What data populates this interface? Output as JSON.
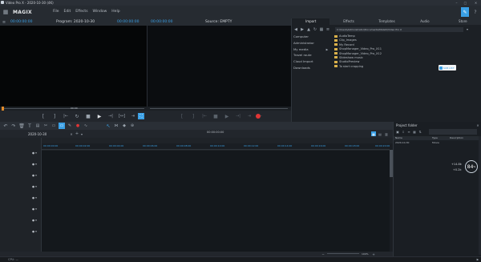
{
  "window": {
    "title": "Video Pro X - 2020-10-30 (4K)"
  },
  "menu": {
    "brand": "MAGIX",
    "items": [
      "File",
      "Edit",
      "Effects",
      "Window",
      "Help"
    ]
  },
  "program_monitor": {
    "timecode_left": "00:00:00:00",
    "label": "Program: 2020-10-30",
    "timecode_right": "00:00:00:00",
    "ruler_value": "00:00"
  },
  "source_monitor": {
    "timecode": "00:00:00:00",
    "label": "Source: EMPTY"
  },
  "media_pool": {
    "tabs": [
      "Import",
      "Effects",
      "Templates",
      "Audio",
      "Store"
    ],
    "path": "C:\\Users\\Administrator\\Documents\\MAGIX\\Video Pro X",
    "places": [
      "Computer",
      "Administrator",
      "My media",
      "Travel route",
      "Cloud Import",
      "Downloads"
    ],
    "files": [
      "AudioTemp",
      "Clip_Images",
      "My Record",
      "ShopManager_Video_Pro_X11",
      "ShopManager_Video_Pro_X12",
      "Slideshow music",
      "StudioPreview",
      "To start cropping"
    ],
    "sub_btn": "SUB LIST"
  },
  "timeline": {
    "tab": "2020-10-30",
    "tab_timecode": "00:00:00:00",
    "ruler_labels": [
      "00:00:00:00",
      "00:00:02:00",
      "00:00:04:00",
      "00:00:06:00",
      "00:00:08:00",
      "00:00:10:00",
      "00:00:12:00",
      "00:00:14:00",
      "00:00:16:00",
      "00:00:18:00",
      "00:00:20:00"
    ],
    "zoom_label": "100%"
  },
  "project_folder": {
    "title": "Project folder",
    "columns": [
      "Name",
      "Type",
      "Description"
    ],
    "rows": [
      {
        "name": "2020-10-30",
        "type": "Movie",
        "description": ""
      }
    ],
    "meter": {
      "value": "84",
      "unit": "%",
      "upload": "+14.8k",
      "download": "+0.2k"
    }
  },
  "bottom": {
    "status": "CPU: —"
  }
}
